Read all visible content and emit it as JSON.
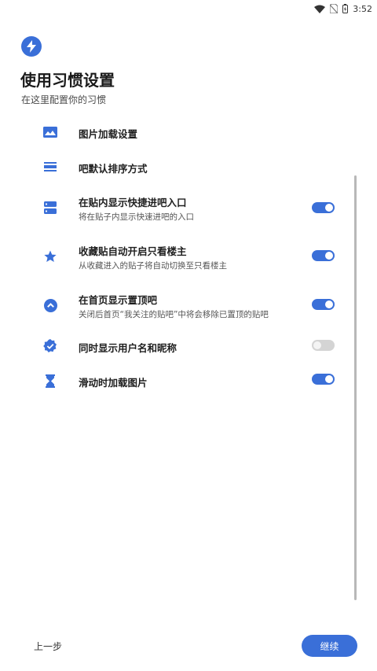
{
  "status_bar": {
    "time": "3:52",
    "icons": [
      "wifi-icon",
      "no-sim-icon",
      "battery-icon"
    ]
  },
  "header": {
    "icon": "lightning-icon",
    "title": "使用习惯设置",
    "subtitle": "在这里配置你的习惯"
  },
  "settings": [
    {
      "icon": "image-icon",
      "title": "图片加载设置",
      "desc": "",
      "toggle": null
    },
    {
      "icon": "sort-icon",
      "title": "吧默认排序方式",
      "desc": "",
      "toggle": null
    },
    {
      "icon": "storage-icon",
      "title": "在贴内显示快捷进吧入口",
      "desc": "将在贴子内显示快速进吧的入口",
      "toggle": true
    },
    {
      "icon": "star-icon",
      "title": "收藏贴自动开启只看楼主",
      "desc": "从收藏进入的贴子将自动切换至只看楼主",
      "toggle": true
    },
    {
      "icon": "arrow-up-circle-icon",
      "title": "在首页显示置顶吧",
      "desc": "关闭后首页“我关注的贴吧”中将会移除已置顶的贴吧",
      "toggle": true
    },
    {
      "icon": "verified-badge-icon",
      "title": "同时显示用户名和昵称",
      "desc": "",
      "toggle": false
    },
    {
      "icon": "hourglass-icon",
      "title": "滑动时加载图片",
      "desc": "",
      "toggle": true
    }
  ],
  "footer": {
    "back_label": "上一步",
    "continue_label": "继续"
  },
  "colors": {
    "accent": "#3a6fd8",
    "toggle_off": "#d4d4d4"
  }
}
